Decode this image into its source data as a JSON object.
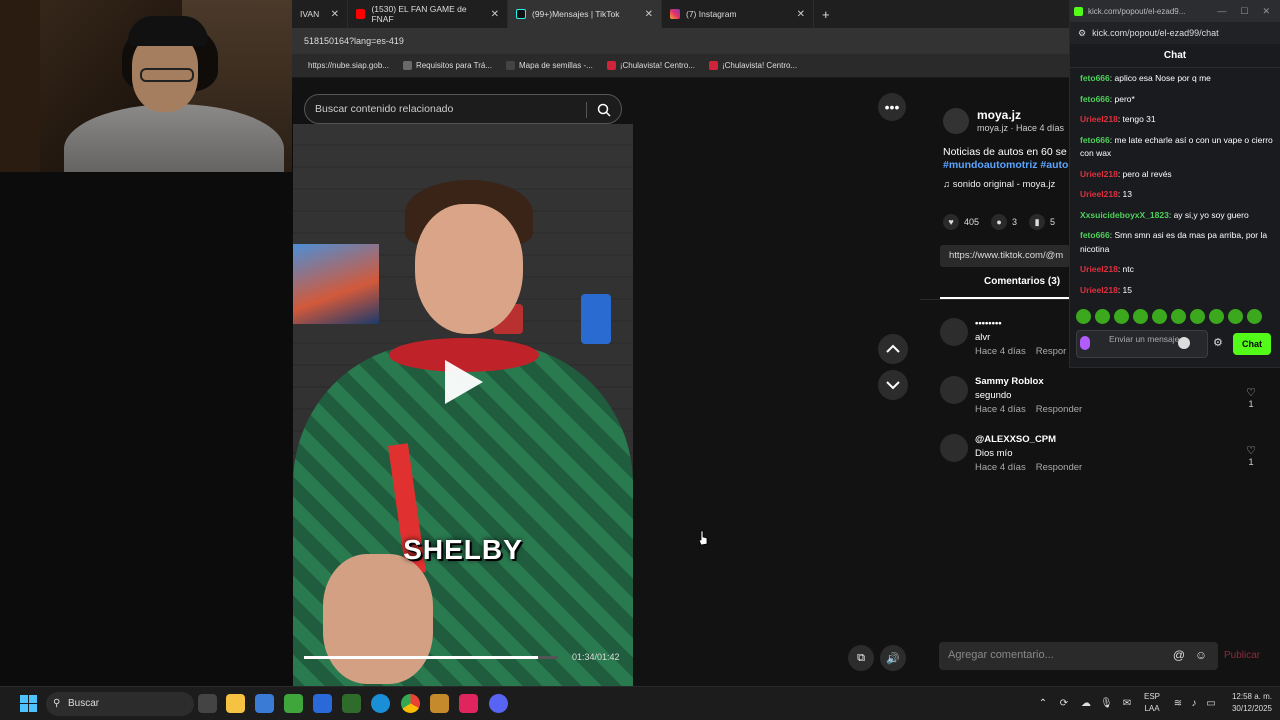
{
  "browser": {
    "tabs": [
      {
        "label": "IVAN",
        "active": false
      },
      {
        "label": "(1530) EL FAN GAME de FNAF",
        "active": false
      },
      {
        "label": "(99+)Mensajes | TikTok",
        "active": true
      },
      {
        "label": "(7) Instagram",
        "active": false
      }
    ],
    "new_tab": "+",
    "url": "518150164?lang=es-419",
    "bookmarks": [
      "https://nube.siap.gob...",
      "Requisitos para Trá...",
      "Mapa de semillas -...",
      "¡Chulavista! Centro...",
      "¡Chulavista! Centro..."
    ]
  },
  "tiktok": {
    "search_placeholder": "Buscar contenido relacionado",
    "more": "•••",
    "caption": "SHELBY",
    "progress": 0.92,
    "time": "01:34/01:42",
    "author": {
      "name": "moya.jz",
      "sub": "moya.jz · Hace 4 días"
    },
    "description": "Noticias de autos en 60 se",
    "tags": "#mundoautomotriz #auto",
    "sound": "♫  sonido original - moya.jz",
    "actions": {
      "likes": "405",
      "comments": "3",
      "saves": "5"
    },
    "link": "https://www.tiktok.com/@m",
    "comments_tab": "Comentarios (3)",
    "comments": [
      {
        "user": "••••••••",
        "text": "alvr",
        "time": "Hace 4 días",
        "reply": "Respor",
        "likes": ""
      },
      {
        "user": "Sammy Roblox",
        "text": "segundo",
        "time": "Hace 4 días",
        "reply": "Responder",
        "likes": "1"
      },
      {
        "user": "@ALEXXSO_CPM",
        "text": "Dios mío",
        "time": "Hace 4 días",
        "reply": "Responder",
        "likes": "1"
      }
    ],
    "add_comment_placeholder": "Agregar comentario...",
    "at_icon": "@",
    "publish": "Publicar"
  },
  "kick": {
    "window_title": "kick.com/popout/el-ezad9...",
    "url": "kick.com/popout/el-ezad99/chat",
    "chat_title": "Chat",
    "messages": [
      {
        "user": "feto666",
        "text": ": aplico esa Nose por q me",
        "color": "#4fd15a"
      },
      {
        "user": "feto666",
        "text": ": pero*",
        "color": "#4fd15a"
      },
      {
        "user": "Urieel218",
        "text": ": tengo 31",
        "color": "#e0303e"
      },
      {
        "user": "feto666",
        "text": ": me late echarle así o con un vape o cierro con wax",
        "color": "#4fd15a"
      },
      {
        "user": "Urieel218",
        "text": ": pero al revés",
        "color": "#e0303e"
      },
      {
        "user": "Urieel218",
        "text": ": 13",
        "color": "#e0303e"
      },
      {
        "user": "XxsuicideboyxX_1823",
        "text": ": ay si,y yo soy guero",
        "color": "#4fd15a"
      },
      {
        "user": "feto666",
        "text": ": Smn smn asi es da mas pa arriba, por la nicotina",
        "color": "#4fd15a"
      },
      {
        "user": "Urieel218",
        "text": ": ntc",
        "color": "#e0303e"
      },
      {
        "user": "Urieel218",
        "text": ": 15",
        "color": "#e0303e"
      }
    ],
    "input_placeholder": "Enviar un mensaje",
    "send_label": "Chat"
  },
  "taskbar": {
    "search": "Buscar",
    "lang": "ESP",
    "lang2": "LAA",
    "time": "12:58 a. m.",
    "date": "30/12/2025"
  }
}
